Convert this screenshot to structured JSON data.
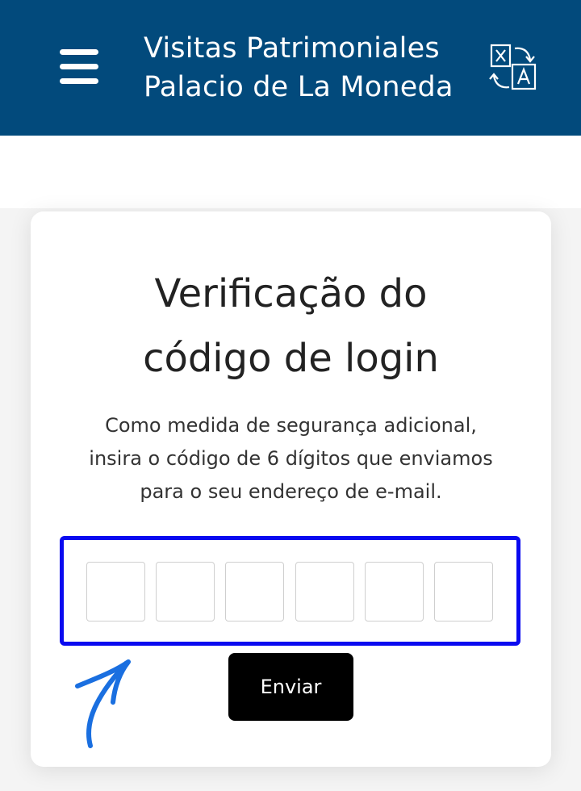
{
  "header": {
    "title_line1": "Visitas Patrimoniales",
    "title_line2": "Palacio de La Moneda",
    "menu_icon": "hamburger-menu-icon",
    "translate_icon": "translate-icon",
    "background_color": "#024a7c"
  },
  "card": {
    "title_line1": "Verificação do",
    "title_line2": "código de login",
    "description_line1": "Como medida de segurança adicional,",
    "description_line2": "insira o código de 6 dígitos que enviamos",
    "description_line3": "para o seu endereço de e-mail.",
    "code_digits": [
      "",
      "",
      "",
      "",
      "",
      ""
    ],
    "submit_label": "Enviar"
  },
  "annotation": {
    "highlight_color": "#0a0af0",
    "arrow_color": "#1a6fe0"
  }
}
